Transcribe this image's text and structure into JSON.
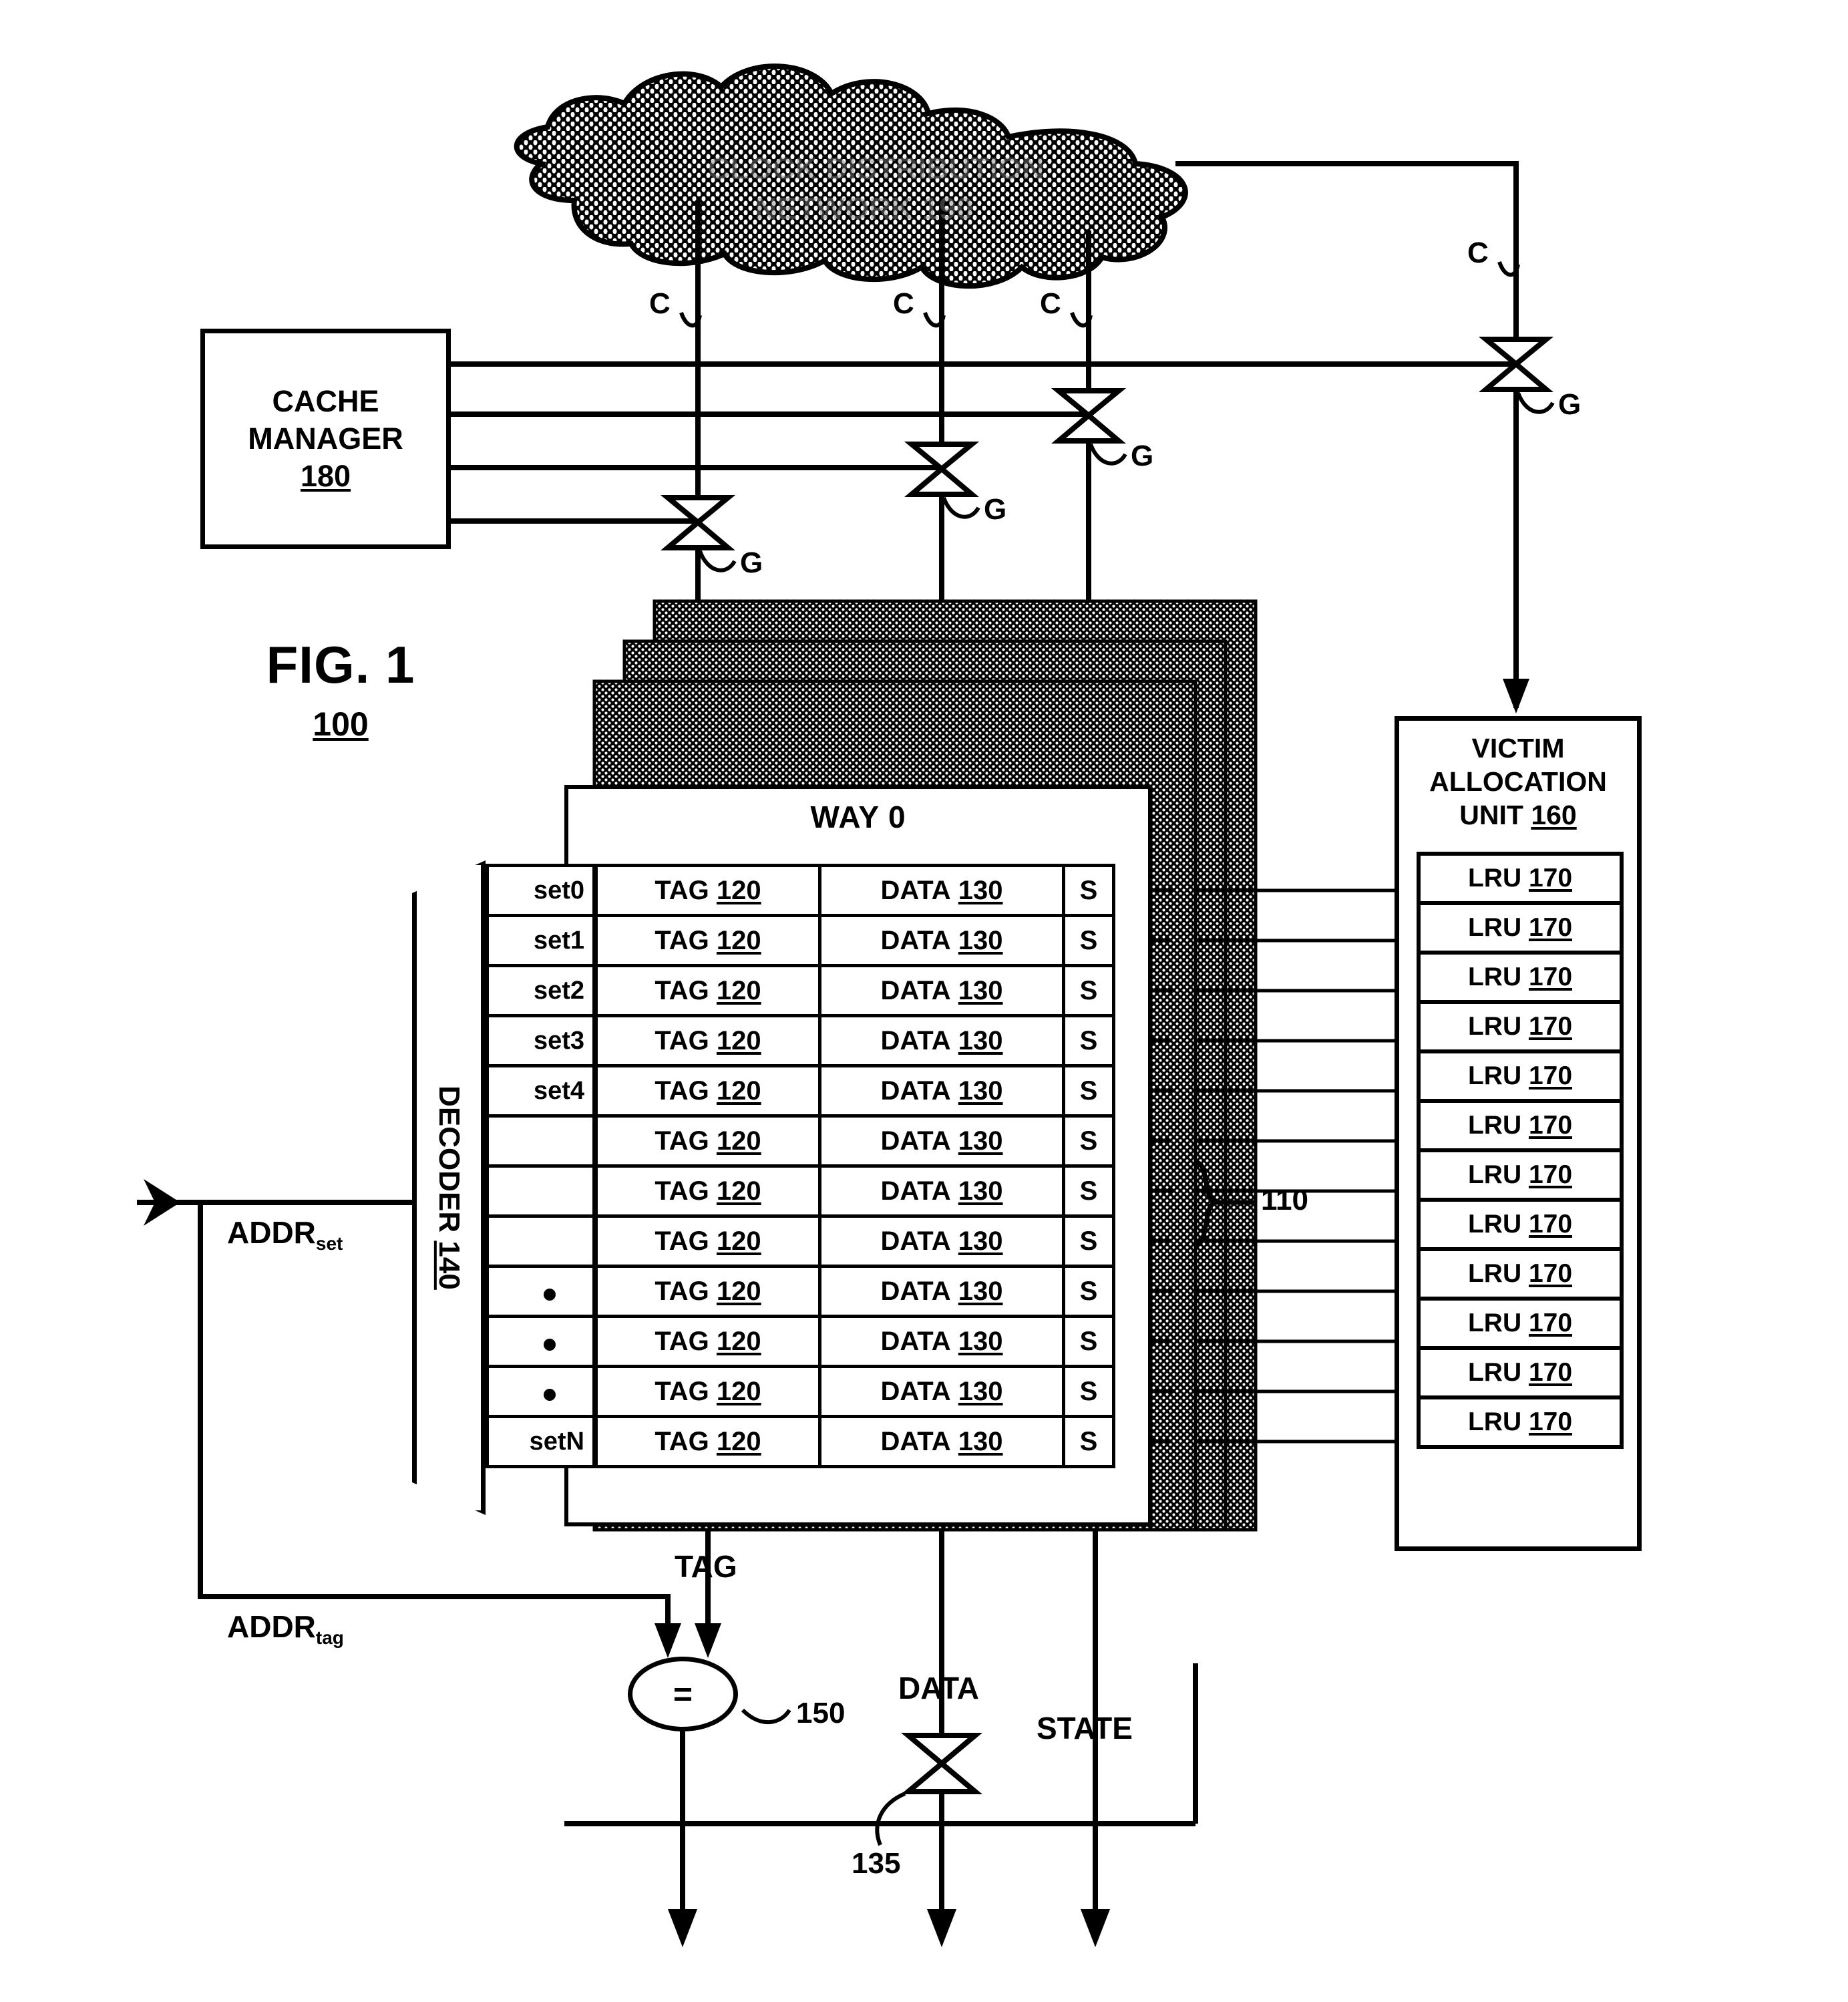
{
  "figure": {
    "caption": "FIG. 1",
    "number": "100"
  },
  "cloud": {
    "line1": "CLOCK DISTRIBUTION",
    "line2": "NETWORK 190",
    "name": "clock-distribution-network"
  },
  "cache_manager": {
    "line1": "CACHE",
    "line2": "MANAGER",
    "ref": "180"
  },
  "victim_unit": {
    "line1": "VICTIM",
    "line2": "ALLOCATION",
    "line3": "UNIT",
    "ref": "160",
    "lru_label": "LRU",
    "lru_ref": "170",
    "lru_count": 12
  },
  "decoder": {
    "label": "DECODER",
    "ref": "140"
  },
  "array": {
    "way_title": "WAY 0",
    "array_ref": "110",
    "columns": [
      "TAG",
      "DATA",
      "S"
    ],
    "tag_label": "TAG",
    "tag_ref": "120",
    "data_label": "DATA",
    "data_ref": "130",
    "state_label": "S",
    "row_count": 12,
    "set_labels": [
      "set0",
      "set1",
      "set2",
      "set3",
      "set4",
      "",
      "",
      "",
      "",
      "",
      "",
      "setN"
    ],
    "ellipsis_rows": [
      8,
      9,
      10
    ]
  },
  "signals": {
    "addr_set": "ADDR",
    "addr_set_sub": "set",
    "addr_tag": "ADDR",
    "addr_tag_sub": "tag",
    "tag_out": "TAG",
    "data_out": "DATA",
    "state_out": "STATE",
    "comparator_symbol": "=",
    "comparator_ref": "150",
    "data_gate_ref": "135",
    "clock_label": "C",
    "gate_label": "G"
  },
  "clock_taps": [
    {
      "label": "C"
    },
    {
      "label": "C"
    },
    {
      "label": "C"
    },
    {
      "label": "C"
    }
  ],
  "clock_gates": [
    {
      "label": "G"
    },
    {
      "label": "G"
    },
    {
      "label": "G"
    },
    {
      "label": "G"
    }
  ],
  "colors": {
    "ink": "#000000",
    "paper": "#ffffff"
  }
}
